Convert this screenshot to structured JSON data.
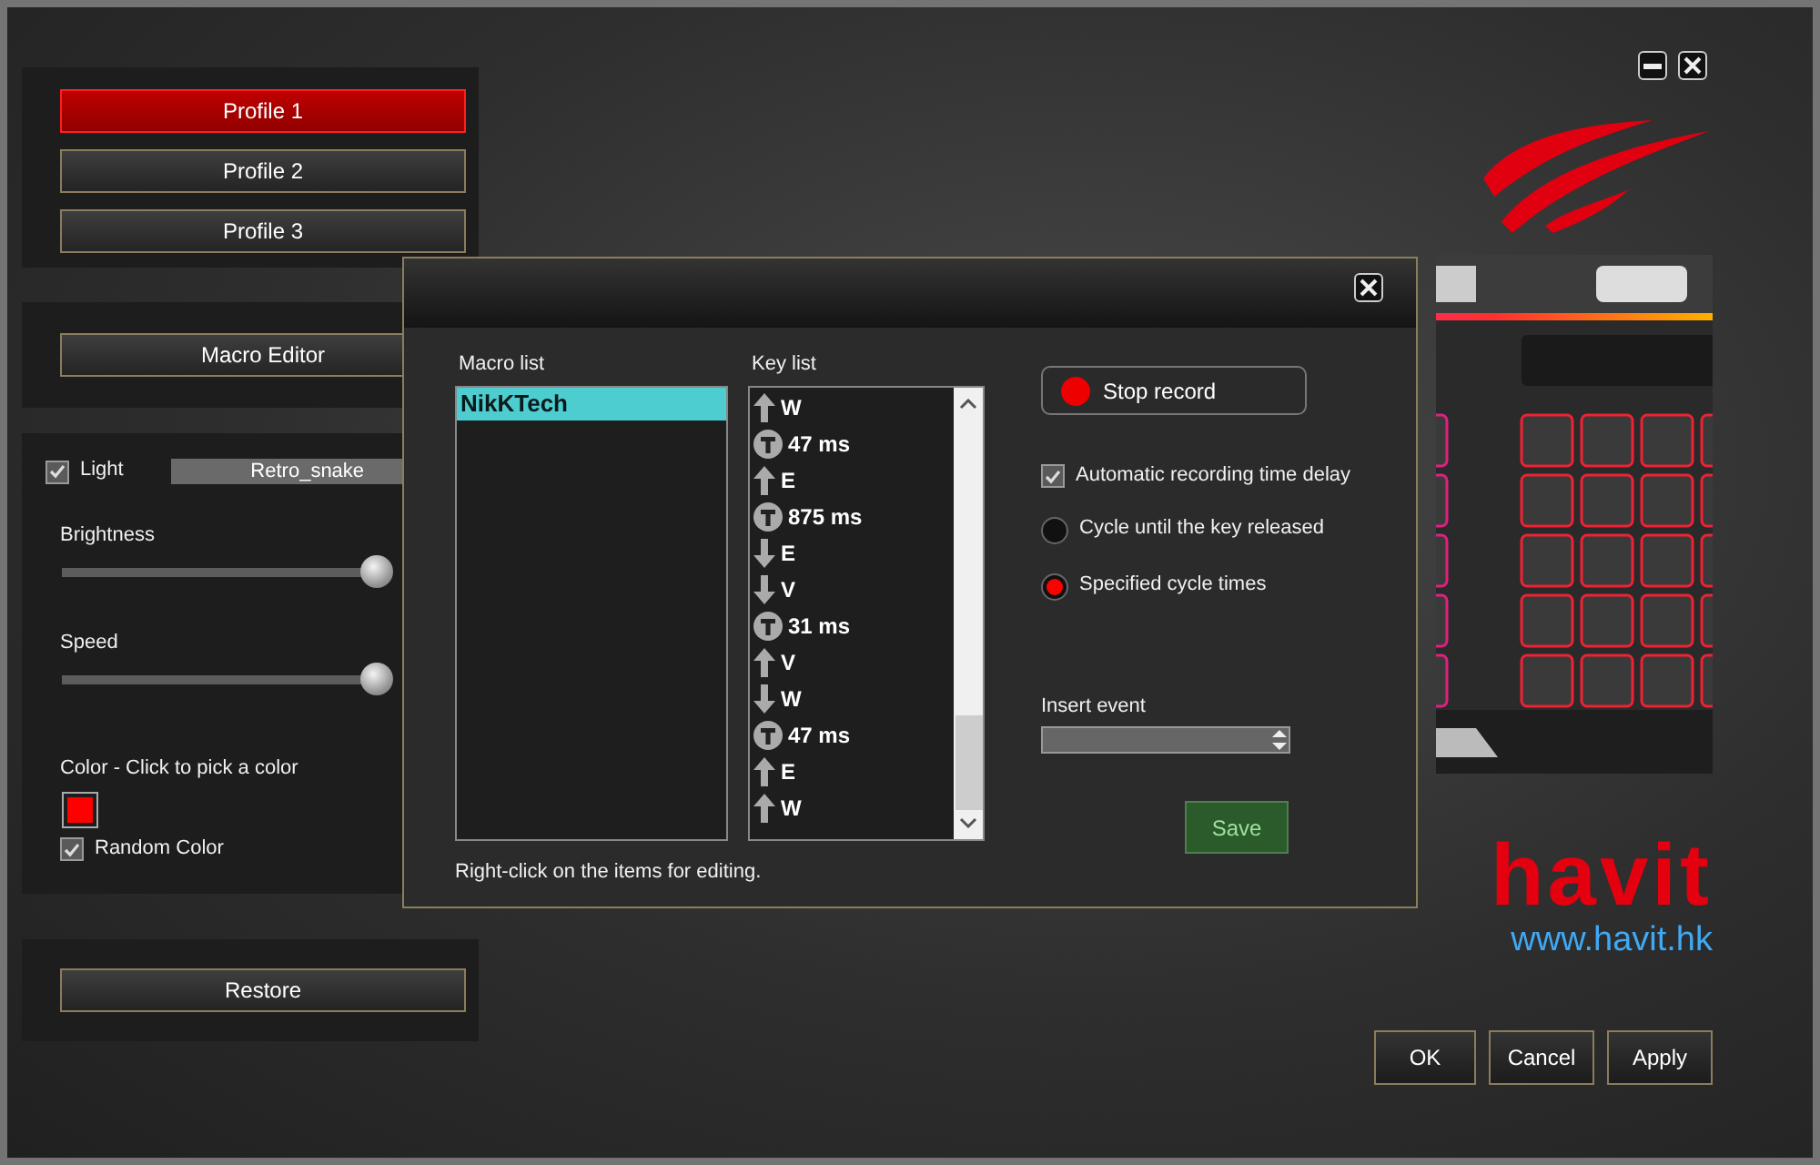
{
  "profiles": [
    {
      "label": "Profile 1",
      "selected": true
    },
    {
      "label": "Profile 2",
      "selected": false
    },
    {
      "label": "Profile 3",
      "selected": false
    }
  ],
  "macro_editor_button": "Macro Editor",
  "light": {
    "label": "Light",
    "checked": true,
    "effect": "Retro_snake"
  },
  "sliders": [
    {
      "label": "Brightness",
      "level": 0.96
    },
    {
      "label": "Speed",
      "level": 0.96
    }
  ],
  "color_picker": {
    "label": "Color  -  Click to pick a color",
    "color": "#ff0000"
  },
  "random_color": {
    "label": "Random Color",
    "checked": true
  },
  "restore_button": "Restore",
  "dialog": {
    "macro_list": {
      "title": "Macro list",
      "items": [
        {
          "label": "NikKTech",
          "selected": true
        }
      ]
    },
    "key_list": {
      "title": "Key list",
      "items": [
        {
          "kind": "up",
          "label": "W"
        },
        {
          "kind": "delay",
          "label": "47 ms"
        },
        {
          "kind": "up",
          "label": "E"
        },
        {
          "kind": "delay",
          "label": "875 ms"
        },
        {
          "kind": "down",
          "label": "E"
        },
        {
          "kind": "down",
          "label": "V"
        },
        {
          "kind": "delay",
          "label": "31 ms"
        },
        {
          "kind": "up",
          "label": "V"
        },
        {
          "kind": "down",
          "label": "W"
        },
        {
          "kind": "delay",
          "label": "47 ms"
        },
        {
          "kind": "up",
          "label": "E"
        },
        {
          "kind": "up",
          "label": "W"
        }
      ]
    },
    "hint": "Right-click on the items for editing.",
    "record_button": "Stop record",
    "options": [
      {
        "kind": "checkbox",
        "label": "Automatic recording time delay",
        "checked": true
      },
      {
        "kind": "radio",
        "label": "Cycle until the key released",
        "selected": false
      },
      {
        "kind": "radio",
        "label": "Specified cycle times",
        "selected": true
      }
    ],
    "insert_event": {
      "label": "Insert event"
    },
    "save_button": "Save"
  },
  "brand": {
    "name": "havit",
    "url": "www.havit.hk"
  },
  "buttons": [
    "OK",
    "Cancel",
    "Apply"
  ]
}
